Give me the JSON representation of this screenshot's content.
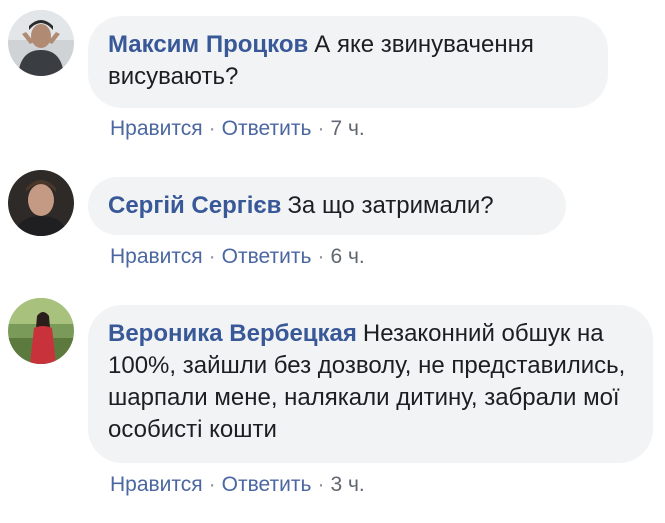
{
  "comments": [
    {
      "author": "Максим Процков",
      "text": "А яке звинувачення висувають?",
      "like_label": "Нравится",
      "reply_label": "Ответить",
      "time": "7 ч.",
      "avatar_icon": "user-avatar-icon"
    },
    {
      "author": "Сергій Сергієв",
      "text": "За що затримали?",
      "like_label": "Нравится",
      "reply_label": "Ответить",
      "time": "6 ч.",
      "avatar_icon": "user-avatar-icon"
    },
    {
      "author": "Вероника Вербецкая",
      "text": "Незаконний обшук на 100%, зайшли без дозволу, не представились, шарпали мене, налякали дитину, забрали мої особисті кошти",
      "like_label": "Нравится",
      "reply_label": "Ответить",
      "time": "3 ч.",
      "avatar_icon": "user-avatar-icon"
    }
  ],
  "separator": "·",
  "colors": {
    "author": "#385898",
    "link": "#4b67a1",
    "bubble_bg": "#f2f3f5",
    "meta": "#606770"
  }
}
